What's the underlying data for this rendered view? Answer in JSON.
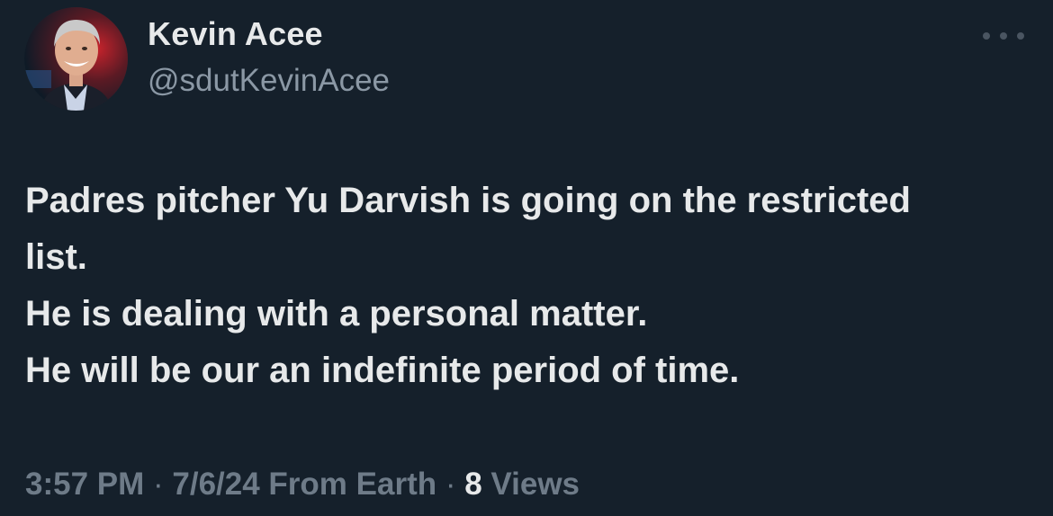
{
  "author": {
    "display_name": "Kevin Acee",
    "handle": "@sdutKevinAcee"
  },
  "tweet": {
    "lines": [
      "Padres pitcher Yu Darvish is going on the restricted",
      "list.",
      "He is dealing with a personal matter.",
      "He will be our an indefinite period of time."
    ]
  },
  "meta": {
    "time": "3:57 PM",
    "separator1": " · ",
    "date": "7/6/24",
    "source": " From Earth",
    "separator2": " · ",
    "views_count": "8",
    "views_label": " Views"
  },
  "icons": {
    "more": "more-horizontal-icon"
  },
  "colors": {
    "background": "#15202b",
    "primary_text": "#e7e9ea",
    "secondary_text": "#8b98a5"
  }
}
